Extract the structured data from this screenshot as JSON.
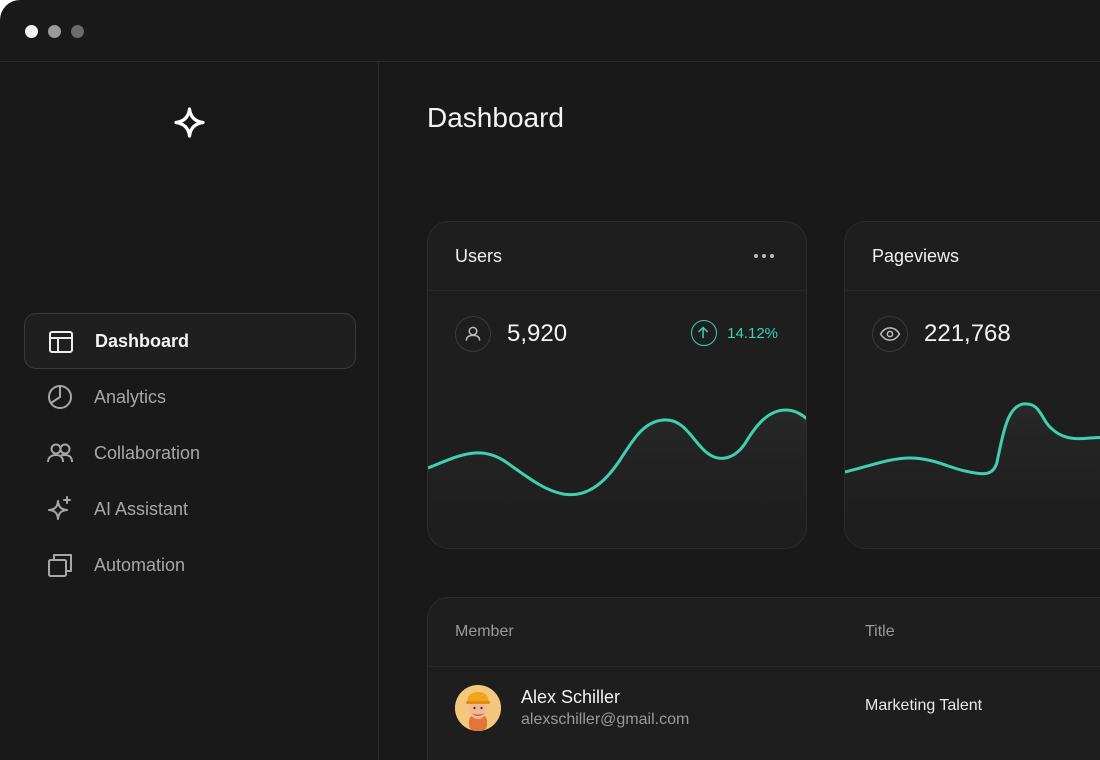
{
  "window": {
    "controls": [
      "close",
      "minimize",
      "maximize"
    ]
  },
  "sidebar": {
    "logo_icon": "sparkle-star-icon",
    "items": [
      {
        "label": "Dashboard",
        "icon": "layout-icon",
        "active": true
      },
      {
        "label": "Analytics",
        "icon": "pie-chart-icon",
        "active": false
      },
      {
        "label": "Collaboration",
        "icon": "users-icon",
        "active": false
      },
      {
        "label": "AI Assistant",
        "icon": "sparkles-icon",
        "active": false
      },
      {
        "label": "Automation",
        "icon": "windows-icon",
        "active": false
      }
    ]
  },
  "main": {
    "title": "Dashboard",
    "cards": [
      {
        "title": "Users",
        "value": "5,920",
        "trend": "14.12%",
        "trend_direction": "up",
        "icon": "user-icon"
      },
      {
        "title": "Pageviews",
        "value": "221,768",
        "icon": "eye-icon"
      }
    ],
    "table": {
      "columns": [
        "Member",
        "Title"
      ],
      "rows": [
        {
          "name": "Alex Schiller",
          "email": "alexschiller@gmail.com",
          "title": "Marketing Talent"
        }
      ]
    }
  },
  "colors": {
    "accent": "#3fd0ae",
    "background": "#191919",
    "card": "#1e1e1e"
  }
}
